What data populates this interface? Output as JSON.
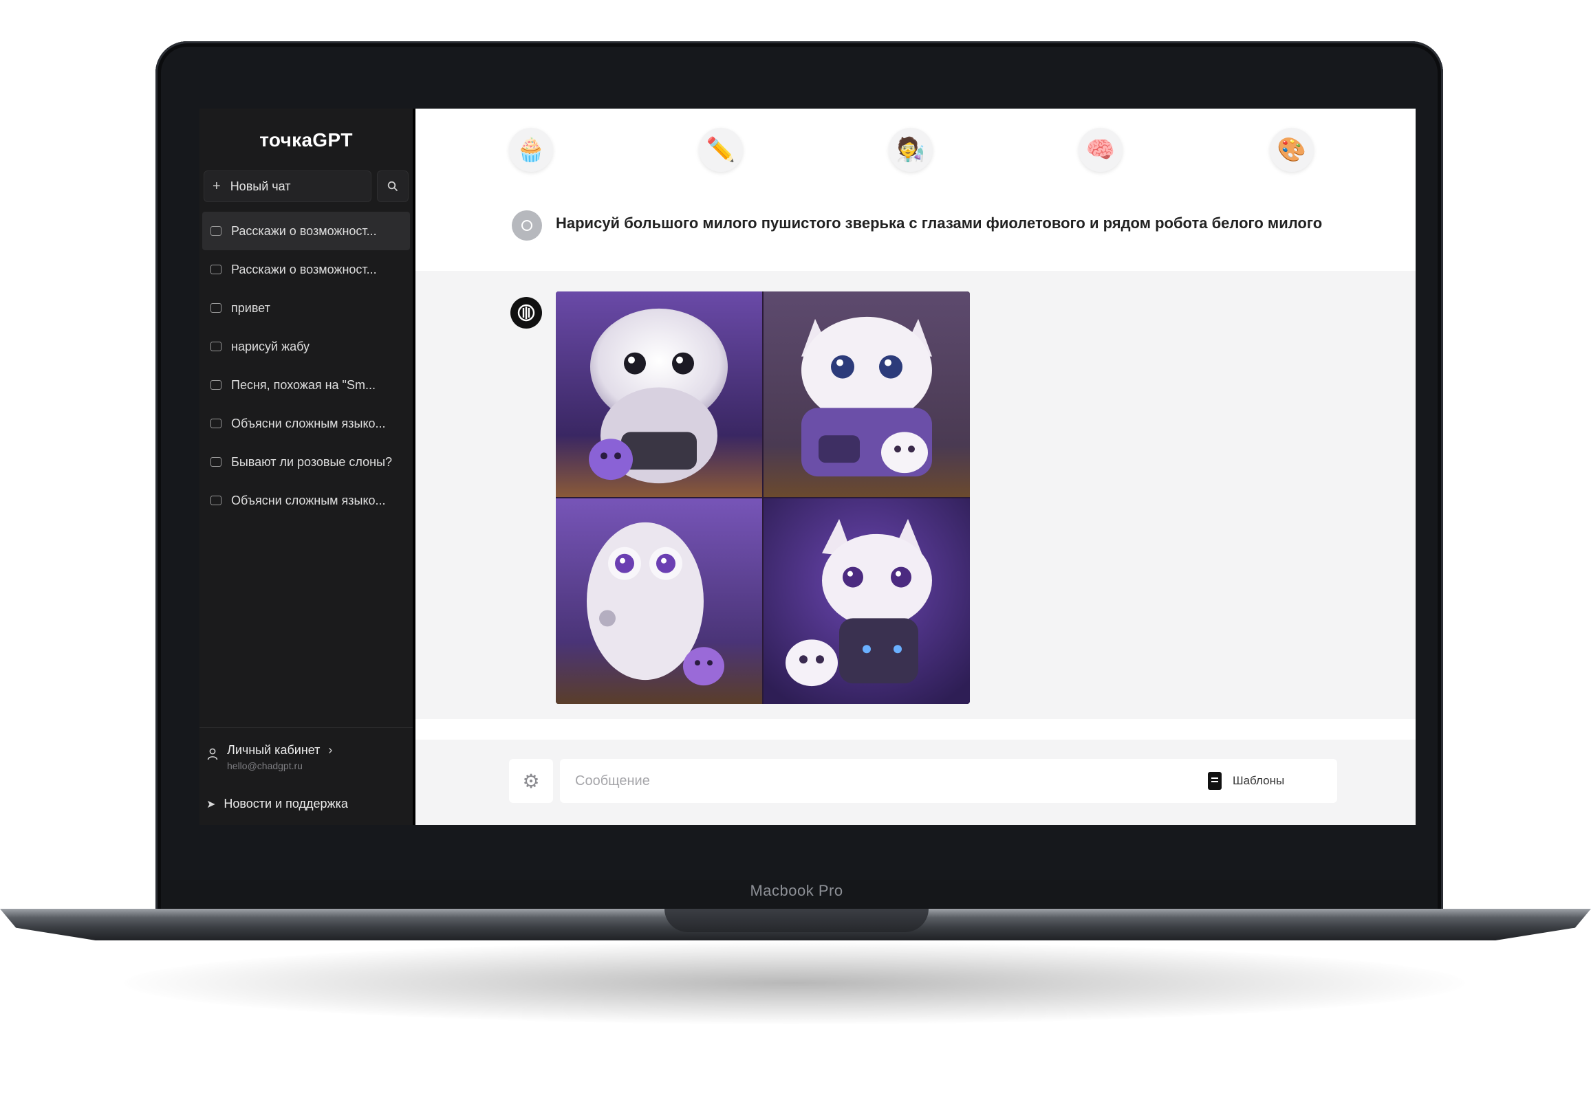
{
  "device": {
    "model_label": "Macbook Pro"
  },
  "sidebar": {
    "logo": "точкаGPT",
    "new_chat_label": "Новый чат",
    "chats": [
      {
        "title": "Расскажи о возможност..."
      },
      {
        "title": "Расскажи о возможност..."
      },
      {
        "title": "привет"
      },
      {
        "title": "нарисуй жабу"
      },
      {
        "title": "Песня, похожая на \"Sm..."
      },
      {
        "title": "Объясни сложным языко..."
      },
      {
        "title": "Бывают ли розовые слоны?"
      },
      {
        "title": "Объясни сложным языко..."
      }
    ],
    "account": {
      "name": "Личный кабинет",
      "email": "hello@chadgpt.ru"
    },
    "support_label": "Новости и поддержка"
  },
  "model_icons": [
    "cupcake-icon",
    "pencil-icon",
    "scientist-icon",
    "brain-icon",
    "palette-icon"
  ],
  "conversation": {
    "user_message": "Нарисуй большого милого пушистого зверька с глазами фиолетового и рядом робота белого милого",
    "bot_images": [
      "fluffy-cat-robot-1",
      "fluffy-cat-robot-2",
      "fluffy-owl-robot-3",
      "fluffy-cat-robot-4"
    ]
  },
  "composer": {
    "placeholder": "Сообщение",
    "templates_label": "Шаблоны"
  },
  "colors": {
    "sidebar_bg": "#1b1b1c",
    "chat_bg": "#f4f4f5",
    "accent_purple": "#7a4fc4"
  }
}
